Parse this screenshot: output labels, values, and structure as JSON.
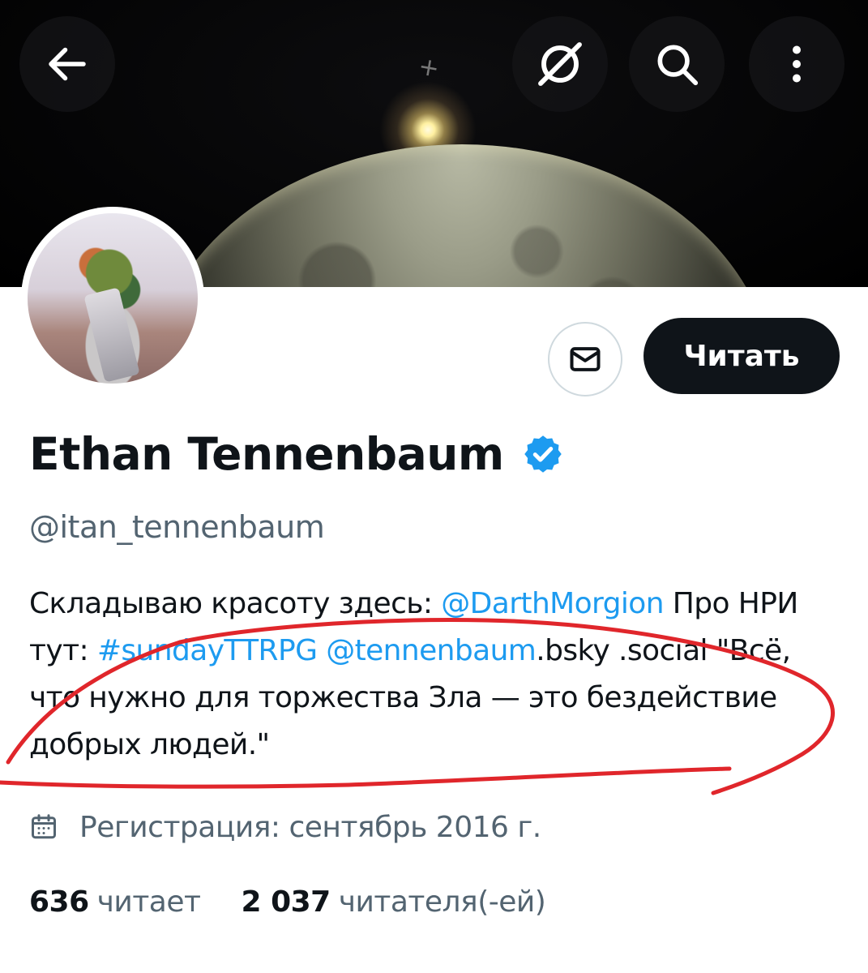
{
  "header": {
    "back_icon": "arrow-left-icon",
    "grok_icon": "grok-slash-icon",
    "search_icon": "search-icon",
    "more_icon": "more-vertical-icon"
  },
  "profile": {
    "display_name": "Ethan Tennenbaum",
    "verified_color": "#1d9bf0",
    "handle": "@itan_tennenbaum",
    "follow_label": "Читать",
    "message_icon": "envelope-icon",
    "bio": {
      "part1": "Складываю красоту здесь: ",
      "mention1": "@DarthMorgion",
      "part2": " Про НРИ тут: ",
      "hashtag": "#sundayTTRPG",
      "part3": "  ",
      "mention2": "@tennenbaum",
      "part4": ".bsky .social  \"Всё, что нужно для торжества Зла — это бездействие добрых людей.\""
    },
    "joined": "Регистрация: сентябрь 2016 г.",
    "calendar_icon": "calendar-icon",
    "following_count": "636",
    "following_label": "читает",
    "followers_count": "2 037",
    "followers_label": "читателя(-ей)"
  },
  "colors": {
    "link": "#1d9bf0",
    "text": "#0f1419",
    "muted": "#536471",
    "annotation": "#e0262b"
  }
}
